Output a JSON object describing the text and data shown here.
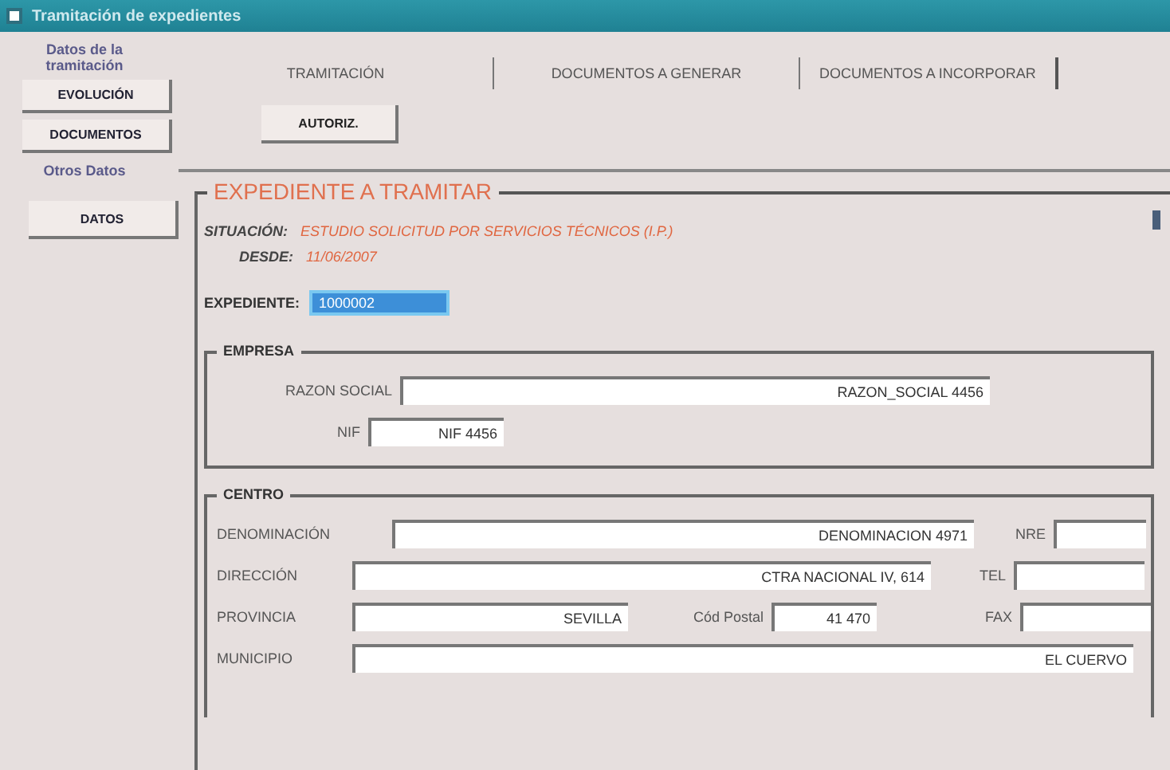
{
  "window": {
    "title": "Tramitación de expedientes"
  },
  "sidebar": {
    "heading": "Datos de la tramitación",
    "buttons": [
      "EVOLUCIÓN",
      "DOCUMENTOS"
    ],
    "other_heading": "Otros Datos",
    "other_buttons": [
      "DATOS"
    ]
  },
  "tabs": [
    {
      "label": "TRAMITACIÓN"
    },
    {
      "label": "DOCUMENTOS A GENERAR"
    },
    {
      "label": "DOCUMENTOS A INCORPORAR"
    }
  ],
  "toolbar": {
    "buttons": [
      "AUTORIZ."
    ]
  },
  "expediente_section": {
    "title": "EXPEDIENTE A TRAMITAR",
    "info": [
      {
        "label": "SITUACIÓN:",
        "value": "ESTUDIO SOLICITUD POR SERVICIOS TÉCNICOS (I.P.)"
      },
      {
        "label": "DESDE:",
        "value": "11/06/2007"
      }
    ],
    "expediente": {
      "label": "EXPEDIENTE:",
      "value": "1000002",
      "selected": true
    },
    "empresa": {
      "title": "EMPRESA",
      "rows": [
        [
          {
            "label": "RAZON SOCIAL",
            "value": "RAZON_SOCIAL 4456"
          }
        ],
        [
          {
            "label": "NIF",
            "value": "NIF 4456"
          }
        ]
      ]
    },
    "centro": {
      "title": "CENTRO",
      "lines": [
        {
          "fields": [
            {
              "label": "DENOMINACIÓN",
              "value": "DENOMINACION 4971"
            },
            {
              "label": "NRE"
            }
          ]
        },
        {
          "fields": [
            {
              "label": "DIRECCIÓN",
              "value": "CTRA NACIONAL IV, 614"
            },
            {
              "label": "TEL"
            }
          ]
        },
        {
          "fields": [
            {
              "label": "PROVINCIA",
              "value": "SEVILLA"
            },
            {
              "label": "Cód Postal",
              "value": "41 470"
            },
            {
              "label": "FAX"
            }
          ]
        },
        {
          "fields": [
            {
              "label": "MUNICIPIO",
              "value": "EL CUERVO"
            }
          ]
        }
      ]
    }
  }
}
